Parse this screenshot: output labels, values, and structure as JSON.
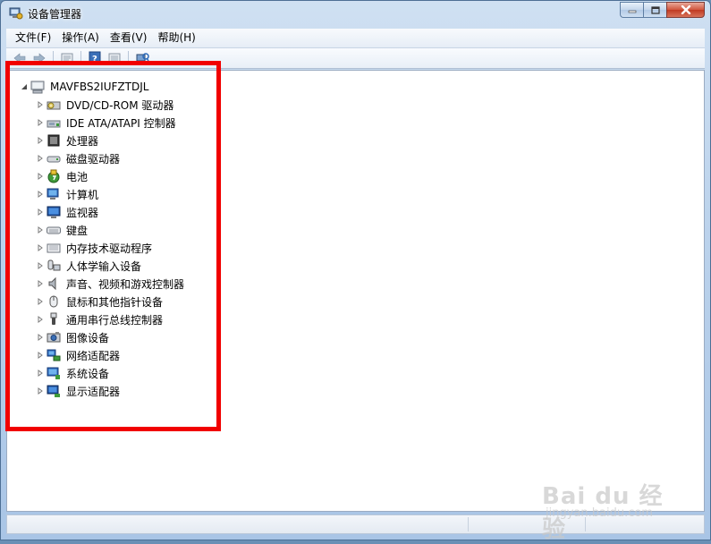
{
  "window": {
    "title": "设备管理器"
  },
  "menu": [
    "文件(F)",
    "操作(A)",
    "查看(V)",
    "帮助(H)"
  ],
  "toolbar": [
    "back-icon",
    "forward-icon",
    "properties-icon",
    "help-icon",
    "update-driver-icon",
    "scan-hardware-icon"
  ],
  "tree": {
    "root_label": "MAVFBS2IUFZTDJL",
    "categories": [
      {
        "label": "DVD/CD-ROM 驱动器",
        "icon": "dvd-drive-icon"
      },
      {
        "label": "IDE ATA/ATAPI 控制器",
        "icon": "ide-controller-icon"
      },
      {
        "label": "处理器",
        "icon": "processor-icon"
      },
      {
        "label": "磁盘驱动器",
        "icon": "disk-drive-icon"
      },
      {
        "label": "电池",
        "icon": "battery-icon"
      },
      {
        "label": "计算机",
        "icon": "computer-icon"
      },
      {
        "label": "监视器",
        "icon": "monitor-icon"
      },
      {
        "label": "键盘",
        "icon": "keyboard-icon"
      },
      {
        "label": "内存技术驱动程序",
        "icon": "memory-icon"
      },
      {
        "label": "人体学输入设备",
        "icon": "hid-icon"
      },
      {
        "label": "声音、视频和游戏控制器",
        "icon": "sound-icon"
      },
      {
        "label": "鼠标和其他指针设备",
        "icon": "mouse-icon"
      },
      {
        "label": "通用串行总线控制器",
        "icon": "usb-icon"
      },
      {
        "label": "图像设备",
        "icon": "camera-icon"
      },
      {
        "label": "网络适配器",
        "icon": "network-icon"
      },
      {
        "label": "系统设备",
        "icon": "system-icon"
      },
      {
        "label": "显示适配器",
        "icon": "display-adapter-icon"
      }
    ]
  },
  "watermark": {
    "main": "Bai du 经验",
    "sub": "jingyan.baidu.com"
  },
  "colors": {
    "highlight": "#f10000",
    "window_frame": "#bcd3ec"
  }
}
